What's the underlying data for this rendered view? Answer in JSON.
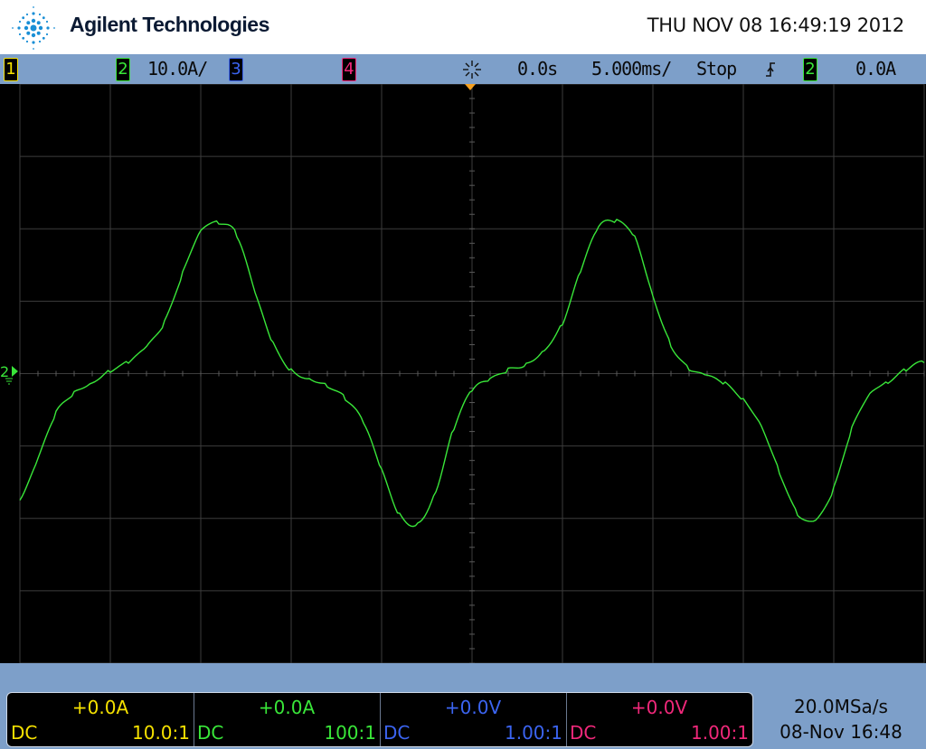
{
  "header": {
    "brand": "Agilent Technologies",
    "datetime": "THU NOV 08 16:49:19 2012"
  },
  "status_bar": {
    "ch1_label": "1",
    "ch2_label": "2",
    "ch2_scale": "10.0A/",
    "ch3_label": "3",
    "ch4_label": "4",
    "time_delay": "0.0s",
    "time_scale": "5.000ms/",
    "run_state": "Stop",
    "trigger_source": "2",
    "trigger_level": "0.0A"
  },
  "channels": [
    {
      "name": "1",
      "offset": "+0.0A",
      "coupling": "DC",
      "probe": "10.0:1",
      "color": "#f5e100"
    },
    {
      "name": "2",
      "offset": "+0.0A",
      "coupling": "DC",
      "probe": "100:1",
      "color": "#39e639"
    },
    {
      "name": "3",
      "offset": "+0.0V",
      "coupling": "DC",
      "probe": "1.00:1",
      "color": "#3b64f0"
    },
    {
      "name": "4",
      "offset": "+0.0V",
      "coupling": "DC",
      "probe": "1.00:1",
      "color": "#f0287a"
    }
  ],
  "acquisition": {
    "sample_rate": "20.0MSa/s",
    "capture_time": "08-Nov 16:48"
  },
  "chart_data": {
    "type": "line",
    "xlabel": "",
    "ylabel": "",
    "x_unit": "ms",
    "y_unit": "A",
    "xlim": [
      -25,
      25
    ],
    "ylim": [
      -40,
      40
    ],
    "grid": true,
    "series": [
      {
        "color": "#39e639",
        "x": [
          -25,
          -24,
          -23,
          -22,
          -21,
          -20,
          -19,
          -18,
          -17,
          -16,
          -15,
          -14,
          -13,
          -12,
          -11,
          -10,
          -9,
          -8,
          -7,
          -6,
          -5,
          -4,
          -3,
          -2,
          -1,
          0,
          1,
          2,
          3,
          4,
          5,
          6,
          7,
          8,
          9,
          10,
          11,
          12,
          13,
          14,
          15,
          16,
          17,
          18,
          19,
          20,
          21,
          22,
          23,
          24,
          25
        ],
        "y": [
          -17.5,
          -12,
          -5.5,
          -2.5,
          -1,
          0.5,
          1.5,
          3.5,
          7,
          14,
          20,
          21,
          19,
          11,
          4,
          0.5,
          -0.5,
          -1.5,
          -3.5,
          -7,
          -13.5,
          -19.5,
          -20.5,
          -16,
          -7.5,
          -2.5,
          -1,
          0.5,
          1.5,
          3.5,
          7,
          14,
          20,
          21,
          19,
          11,
          4,
          0.5,
          -0.5,
          -1.5,
          -3.5,
          -7,
          -13.5,
          -19.5,
          -20.5,
          -16,
          -7.5,
          -2.5,
          -1,
          0.5,
          1.5
        ]
      }
    ]
  }
}
